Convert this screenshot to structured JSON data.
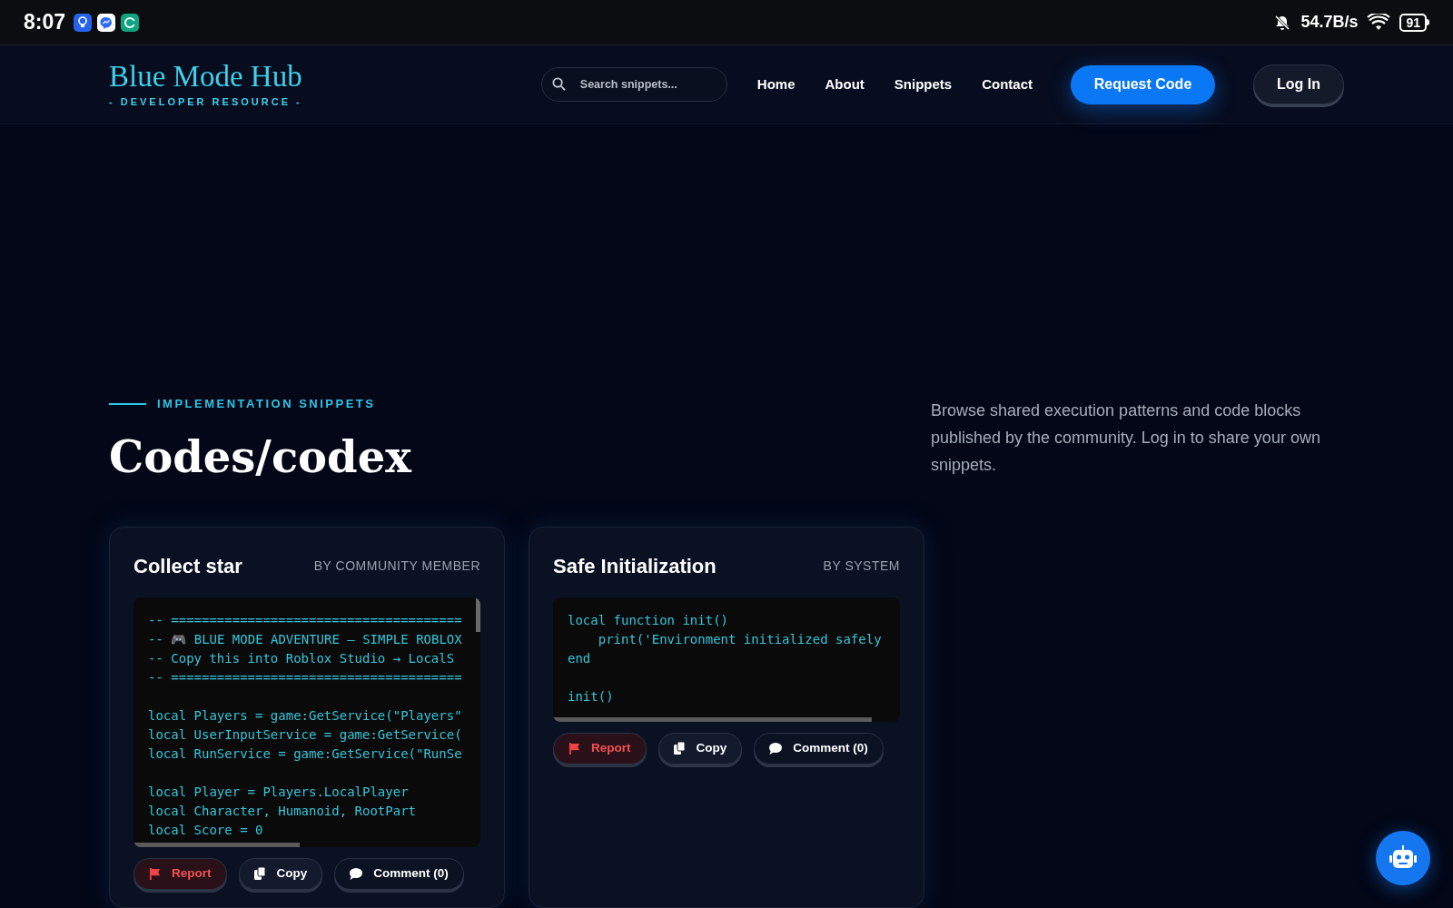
{
  "status_bar": {
    "time": "8:07",
    "speed": "54.7B/s",
    "battery": "91"
  },
  "header": {
    "logo_title": "Blue Mode Hub",
    "logo_subtitle": "- DEVELOPER RESOURCE -",
    "search": {
      "placeholder": "Search snippets..."
    },
    "nav": [
      {
        "label": "Home"
      },
      {
        "label": "About"
      },
      {
        "label": "Snippets"
      },
      {
        "label": "Contact"
      }
    ],
    "request_button": "Request Code",
    "login_button": "Log In"
  },
  "section": {
    "eyebrow": "IMPLEMENTATION SNIPPETS",
    "title": "Codes/codex",
    "description": "Browse shared execution patterns and code blocks published by the community. Log in to share your own snippets."
  },
  "snippets": [
    {
      "title": "Collect star",
      "author": "BY COMMUNITY MEMBER",
      "code": "-- ======================================\n-- 🎮 BLUE MODE ADVENTURE — SIMPLE ROBLOX\n-- Copy this into Roblox Studio → LocalS\n-- ======================================\n\nlocal Players = game:GetService(\"Players\"\nlocal UserInputService = game:GetService(\nlocal RunService = game:GetService(\"RunSe\n\nlocal Player = Players.LocalPlayer\nlocal Character, Humanoid, RootPart\nlocal Score = 0",
      "actions": [
        {
          "kind": "report",
          "label": "Report"
        },
        {
          "kind": "copy",
          "label": "Copy"
        },
        {
          "kind": "comment",
          "label": "Comment (0)"
        }
      ]
    },
    {
      "title": "Safe Initialization",
      "author": "BY SYSTEM",
      "code": "local function init()\n    print('Environment initialized safely\nend\n\ninit()",
      "actions": [
        {
          "kind": "report",
          "label": "Report"
        },
        {
          "kind": "copy",
          "label": "Copy"
        },
        {
          "kind": "comment",
          "label": "Comment (0)"
        }
      ]
    }
  ]
}
